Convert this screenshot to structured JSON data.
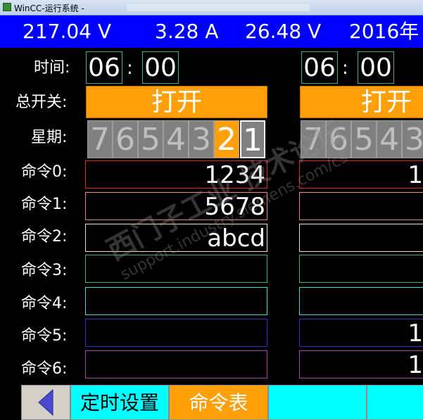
{
  "window": {
    "title": "WinCC-运行系统 -"
  },
  "status": {
    "voltage1": "217.04 V",
    "current": "3.28 A",
    "voltage2": "26.48 V",
    "date": "2016年"
  },
  "labels": {
    "time": "时间:",
    "main_switch": "总开关:",
    "week": "星期:",
    "commands": [
      "命令0:",
      "命令1:",
      "命令2:",
      "命令3:",
      "命令4:",
      "命令5:",
      "命令6:"
    ]
  },
  "left_panel": {
    "hour": "06",
    "colon": ":",
    "minute": "00",
    "switch_label": "打开",
    "weekdays": [
      "7",
      "6",
      "5",
      "4",
      "3",
      "2",
      "1"
    ],
    "command_values": [
      "1234",
      "5678",
      "abcd",
      "",
      "",
      "",
      ""
    ]
  },
  "right_panel": {
    "hour": "06",
    "colon": ":",
    "minute": "00",
    "switch_label": "打开",
    "weekdays": [
      "7",
      "6",
      "5",
      "4",
      "3"
    ],
    "command_values": [
      "1",
      "",
      "",
      "",
      "",
      "1",
      "1"
    ]
  },
  "nav": {
    "timer_settings": "定时设置",
    "command_table": "命令表"
  },
  "colors": {
    "status_bg": "#0000ff",
    "switch_on": "#ff9f0a",
    "cmd_borders": [
      "#dc2a2a",
      "#f08080",
      "#f5deb3",
      "#3cb371",
      "#40e0d0",
      "#3030c0",
      "#b040b0"
    ]
  },
  "watermark": {
    "line1": "西门子工业 技术论坛",
    "line2": "support.industry.siemens.com/cs"
  }
}
